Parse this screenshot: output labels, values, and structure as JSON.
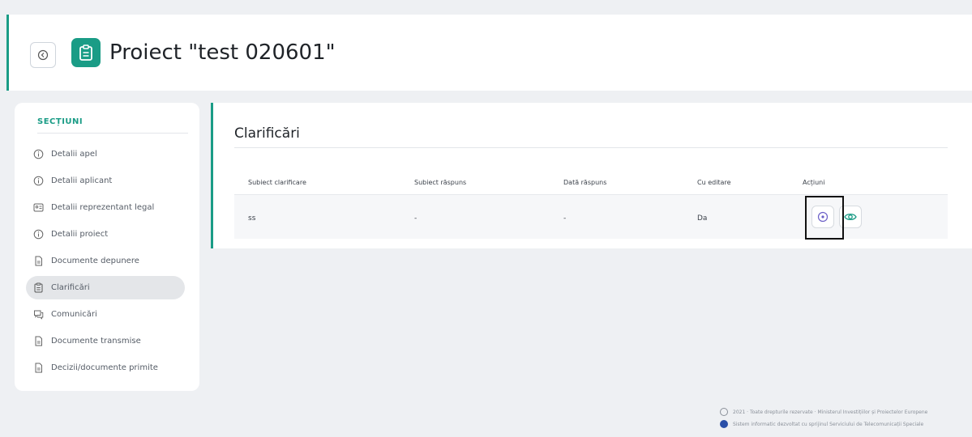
{
  "header": {
    "title": "Proiect \"test 020601\"",
    "back_icon": "back-arrow-icon",
    "title_icon": "clipboard-icon",
    "accent_color": "#1a9c86"
  },
  "sidebar": {
    "heading": "SECȚIUNI",
    "items": [
      {
        "label": "Detalii apel",
        "icon": "info-circle-icon",
        "active": false
      },
      {
        "label": "Detalii aplicant",
        "icon": "info-circle-icon",
        "active": false
      },
      {
        "label": "Detalii reprezentant legal",
        "icon": "id-card-icon",
        "active": false
      },
      {
        "label": "Detalii proiect",
        "icon": "info-circle-icon",
        "active": false
      },
      {
        "label": "Documente depunere",
        "icon": "document-icon",
        "active": false
      },
      {
        "label": "Clarificări",
        "icon": "clipboard-icon",
        "active": true
      },
      {
        "label": "Comunicări",
        "icon": "chat-icon",
        "active": false
      },
      {
        "label": "Documente transmise",
        "icon": "document-icon",
        "active": false
      },
      {
        "label": "Decizii/documente primite",
        "icon": "document-icon",
        "active": false
      }
    ]
  },
  "main": {
    "title": "Clarificări",
    "columns": [
      "Subiect clarificare",
      "Subiect răspuns",
      "Dată răspuns",
      "Cu editare",
      "Acțiuni"
    ],
    "rows": [
      {
        "subiect_clarificare": "ss",
        "subiect_raspuns": "-",
        "data_raspuns": "-",
        "cu_editare": "Da"
      }
    ],
    "actions": [
      "edit-circle-icon",
      "eye-icon"
    ]
  },
  "footer": {
    "line1": "2021 · Toate drepturile rezervate · Ministerul Investițiilor și Proiectelor Europene",
    "line2": "Sistem informatic dezvoltat cu sprijinul Serviciului de Telecomunicații Speciale"
  }
}
